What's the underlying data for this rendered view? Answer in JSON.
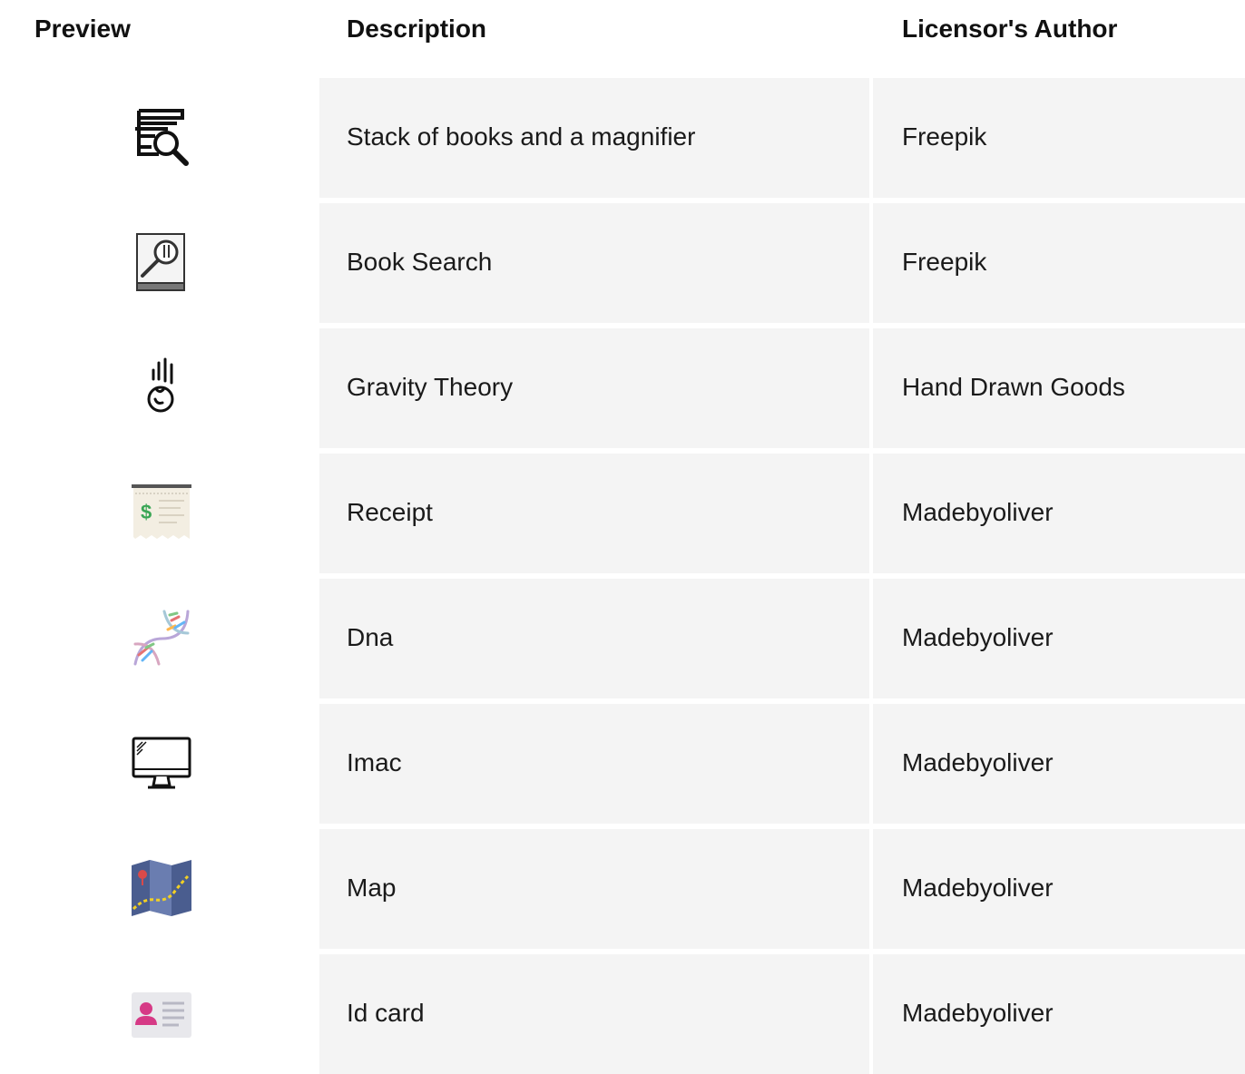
{
  "table": {
    "headers": {
      "preview": "Preview",
      "description": "Description",
      "author": "Licensor's Author"
    },
    "rows": [
      {
        "icon": "books-magnifier-icon",
        "description": "Stack of books and a magnifier",
        "author": "Freepik"
      },
      {
        "icon": "book-search-icon",
        "description": "Book Search",
        "author": "Freepik"
      },
      {
        "icon": "gravity-apple-icon",
        "description": "Gravity Theory",
        "author": "Hand Drawn Goods"
      },
      {
        "icon": "receipt-icon",
        "description": "Receipt",
        "author": "Madebyoliver"
      },
      {
        "icon": "dna-icon",
        "description": "Dna",
        "author": "Madebyoliver"
      },
      {
        "icon": "imac-icon",
        "description": "Imac",
        "author": "Madebyoliver"
      },
      {
        "icon": "map-icon",
        "description": "Map",
        "author": "Madebyoliver"
      },
      {
        "icon": "id-card-icon",
        "description": "Id card",
        "author": "Madebyoliver"
      }
    ]
  },
  "colors": {
    "cell_background": "#f4f4f4",
    "receipt_dollar": "#3aa655",
    "map_blue": "#4a5d8f",
    "map_yellow": "#f2d024",
    "id_card_pink": "#d63a86"
  }
}
